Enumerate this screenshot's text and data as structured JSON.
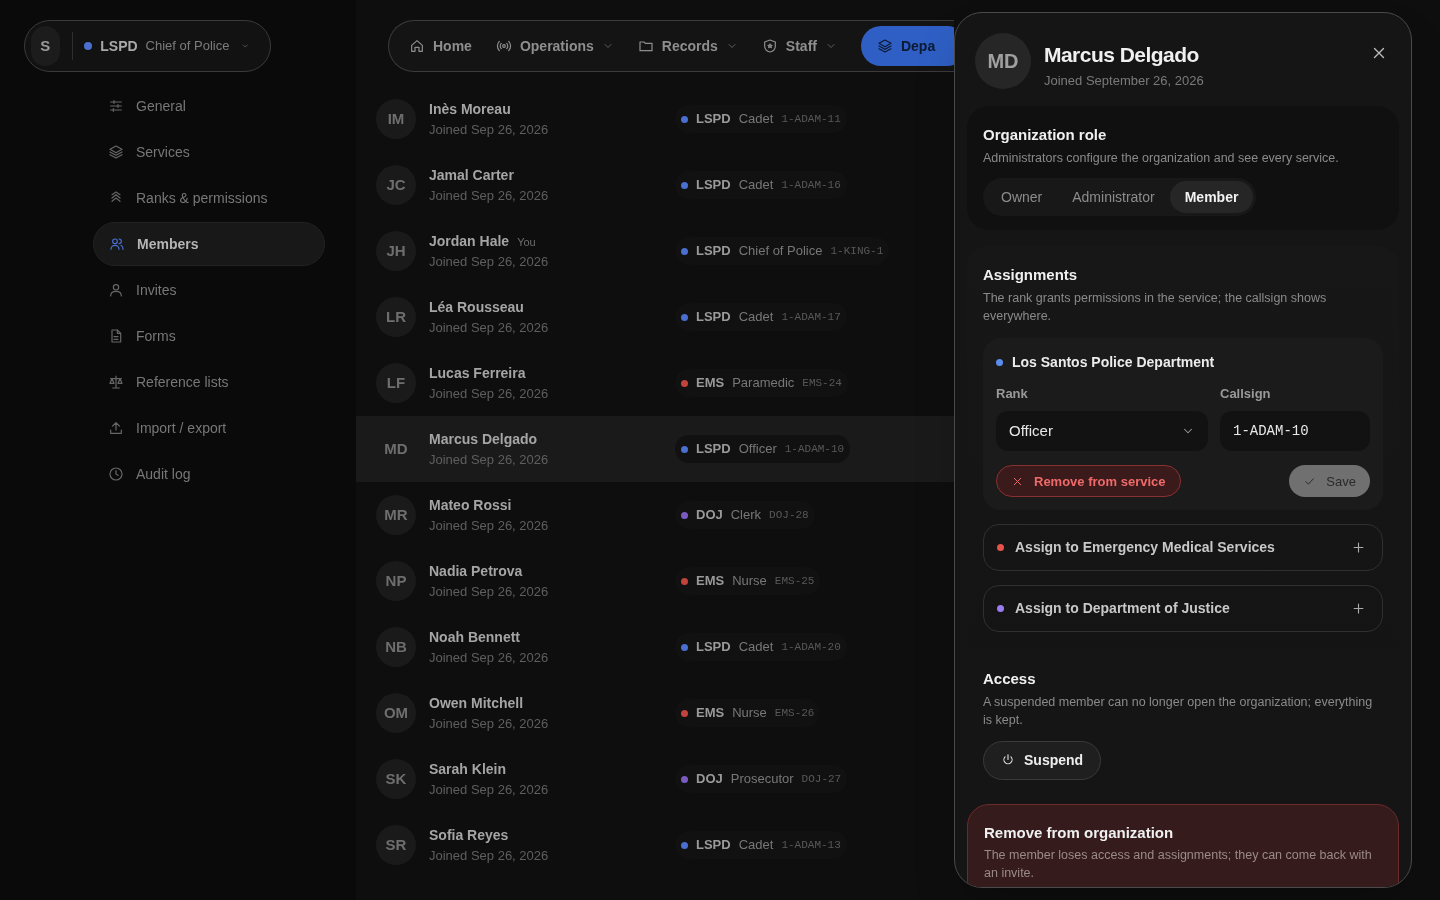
{
  "sidebar": {
    "org_switcher": {
      "avatar": "S",
      "code": "LSPD",
      "role": "Chief of Police",
      "color": "#4a6fd0"
    },
    "items": [
      {
        "label": "General",
        "selected": false
      },
      {
        "label": "Services",
        "selected": false
      },
      {
        "label": "Ranks & permissions",
        "selected": false
      },
      {
        "label": "Members",
        "selected": true
      },
      {
        "label": "Invites",
        "selected": false
      },
      {
        "label": "Forms",
        "selected": false
      },
      {
        "label": "Reference lists",
        "selected": false
      },
      {
        "label": "Import / export",
        "selected": false
      },
      {
        "label": "Audit log",
        "selected": false
      }
    ]
  },
  "top_nav": [
    {
      "label": "Home",
      "has_menu": false,
      "selected": false
    },
    {
      "label": "Operations",
      "has_menu": true,
      "selected": false
    },
    {
      "label": "Records",
      "has_menu": true,
      "selected": false
    },
    {
      "label": "Staff",
      "has_menu": true,
      "selected": false
    },
    {
      "label": "Depa",
      "has_menu": false,
      "selected": true
    }
  ],
  "members": [
    {
      "initials": "IM",
      "name": "Inès Moreau",
      "joined": "Joined Sep 26, 2026",
      "selected": false,
      "service": {
        "code": "LSPD",
        "role": "Cadet",
        "callsign": "1-ADAM-11",
        "color": "#4a6fd0"
      }
    },
    {
      "initials": "JC",
      "name": "Jamal Carter",
      "joined": "Joined Sep 26, 2026",
      "selected": false,
      "service": {
        "code": "LSPD",
        "role": "Cadet",
        "callsign": "1-ADAM-16",
        "color": "#4a6fd0"
      }
    },
    {
      "initials": "JH",
      "name": "Jordan Hale",
      "tag": "You",
      "joined": "Joined Sep 26, 2026",
      "selected": false,
      "service": {
        "code": "LSPD",
        "role": "Chief of Police",
        "callsign": "1-KING-1",
        "color": "#4a6fd0"
      }
    },
    {
      "initials": "LR",
      "name": "Léa Rousseau",
      "joined": "Joined Sep 26, 2026",
      "selected": false,
      "service": {
        "code": "LSPD",
        "role": "Cadet",
        "callsign": "1-ADAM-17",
        "color": "#4a6fd0"
      }
    },
    {
      "initials": "LF",
      "name": "Lucas Ferreira",
      "joined": "Joined Sep 26, 2026",
      "selected": false,
      "service": {
        "code": "EMS",
        "role": "Paramedic",
        "callsign": "EMS-24",
        "color": "#c0443c"
      }
    },
    {
      "initials": "MD",
      "name": "Marcus Delgado",
      "joined": "Joined Sep 26, 2026",
      "selected": true,
      "service": {
        "code": "LSPD",
        "role": "Officer",
        "callsign": "1-ADAM-10",
        "color": "#4a6fd0"
      }
    },
    {
      "initials": "MR",
      "name": "Mateo Rossi",
      "joined": "Joined Sep 26, 2026",
      "selected": false,
      "service": {
        "code": "DOJ",
        "role": "Clerk",
        "callsign": "DOJ-28",
        "color": "#7a5cc0"
      }
    },
    {
      "initials": "NP",
      "name": "Nadia Petrova",
      "joined": "Joined Sep 26, 2026",
      "selected": false,
      "service": {
        "code": "EMS",
        "role": "Nurse",
        "callsign": "EMS-25",
        "color": "#c0443c"
      }
    },
    {
      "initials": "NB",
      "name": "Noah Bennett",
      "joined": "Joined Sep 26, 2026",
      "selected": false,
      "service": {
        "code": "LSPD",
        "role": "Cadet",
        "callsign": "1-ADAM-20",
        "color": "#4a6fd0"
      }
    },
    {
      "initials": "OM",
      "name": "Owen Mitchell",
      "joined": "Joined Sep 26, 2026",
      "selected": false,
      "service": {
        "code": "EMS",
        "role": "Nurse",
        "callsign": "EMS-26",
        "color": "#c0443c"
      }
    },
    {
      "initials": "SK",
      "name": "Sarah Klein",
      "joined": "Joined Sep 26, 2026",
      "selected": false,
      "service": {
        "code": "DOJ",
        "role": "Prosecutor",
        "callsign": "DOJ-27",
        "color": "#7a5cc0"
      }
    },
    {
      "initials": "SR",
      "name": "Sofia Reyes",
      "joined": "Joined Sep 26, 2026",
      "selected": false,
      "service": {
        "code": "LSPD",
        "role": "Cadet",
        "callsign": "1-ADAM-13",
        "color": "#4a6fd0"
      }
    }
  ],
  "drawer": {
    "avatar": "MD",
    "name": "Marcus Delgado",
    "joined": "Joined September 26, 2026",
    "org_role": {
      "title": "Organization role",
      "description": "Administrators configure the organization and see every service.",
      "options": [
        {
          "label": "Owner",
          "selected": false
        },
        {
          "label": "Administrator",
          "selected": false
        },
        {
          "label": "Member",
          "selected": true
        }
      ]
    },
    "assignments": {
      "title": "Assignments",
      "description": "The rank grants permissions in the service; the callsign shows everywhere.",
      "current": {
        "service": "Los Santos Police Department",
        "color": "#5b8def",
        "rank_label": "Rank",
        "rank_value": "Officer",
        "callsign_label": "Callsign",
        "callsign_value": "1-ADAM-10",
        "remove_label": "Remove from service",
        "save_label": "Save",
        "save_disabled": true
      },
      "available": [
        {
          "label": "Assign to Emergency Medical Services",
          "color": "#e5534b"
        },
        {
          "label": "Assign to Department of Justice",
          "color": "#9b7cf0"
        }
      ]
    },
    "access": {
      "title": "Access",
      "description": "A suspended member can no longer open the organization; everything is kept.",
      "button": "Suspend"
    },
    "danger": {
      "title": "Remove from organization",
      "description": "The member loses access and assignments; they can come back with an invite."
    }
  }
}
